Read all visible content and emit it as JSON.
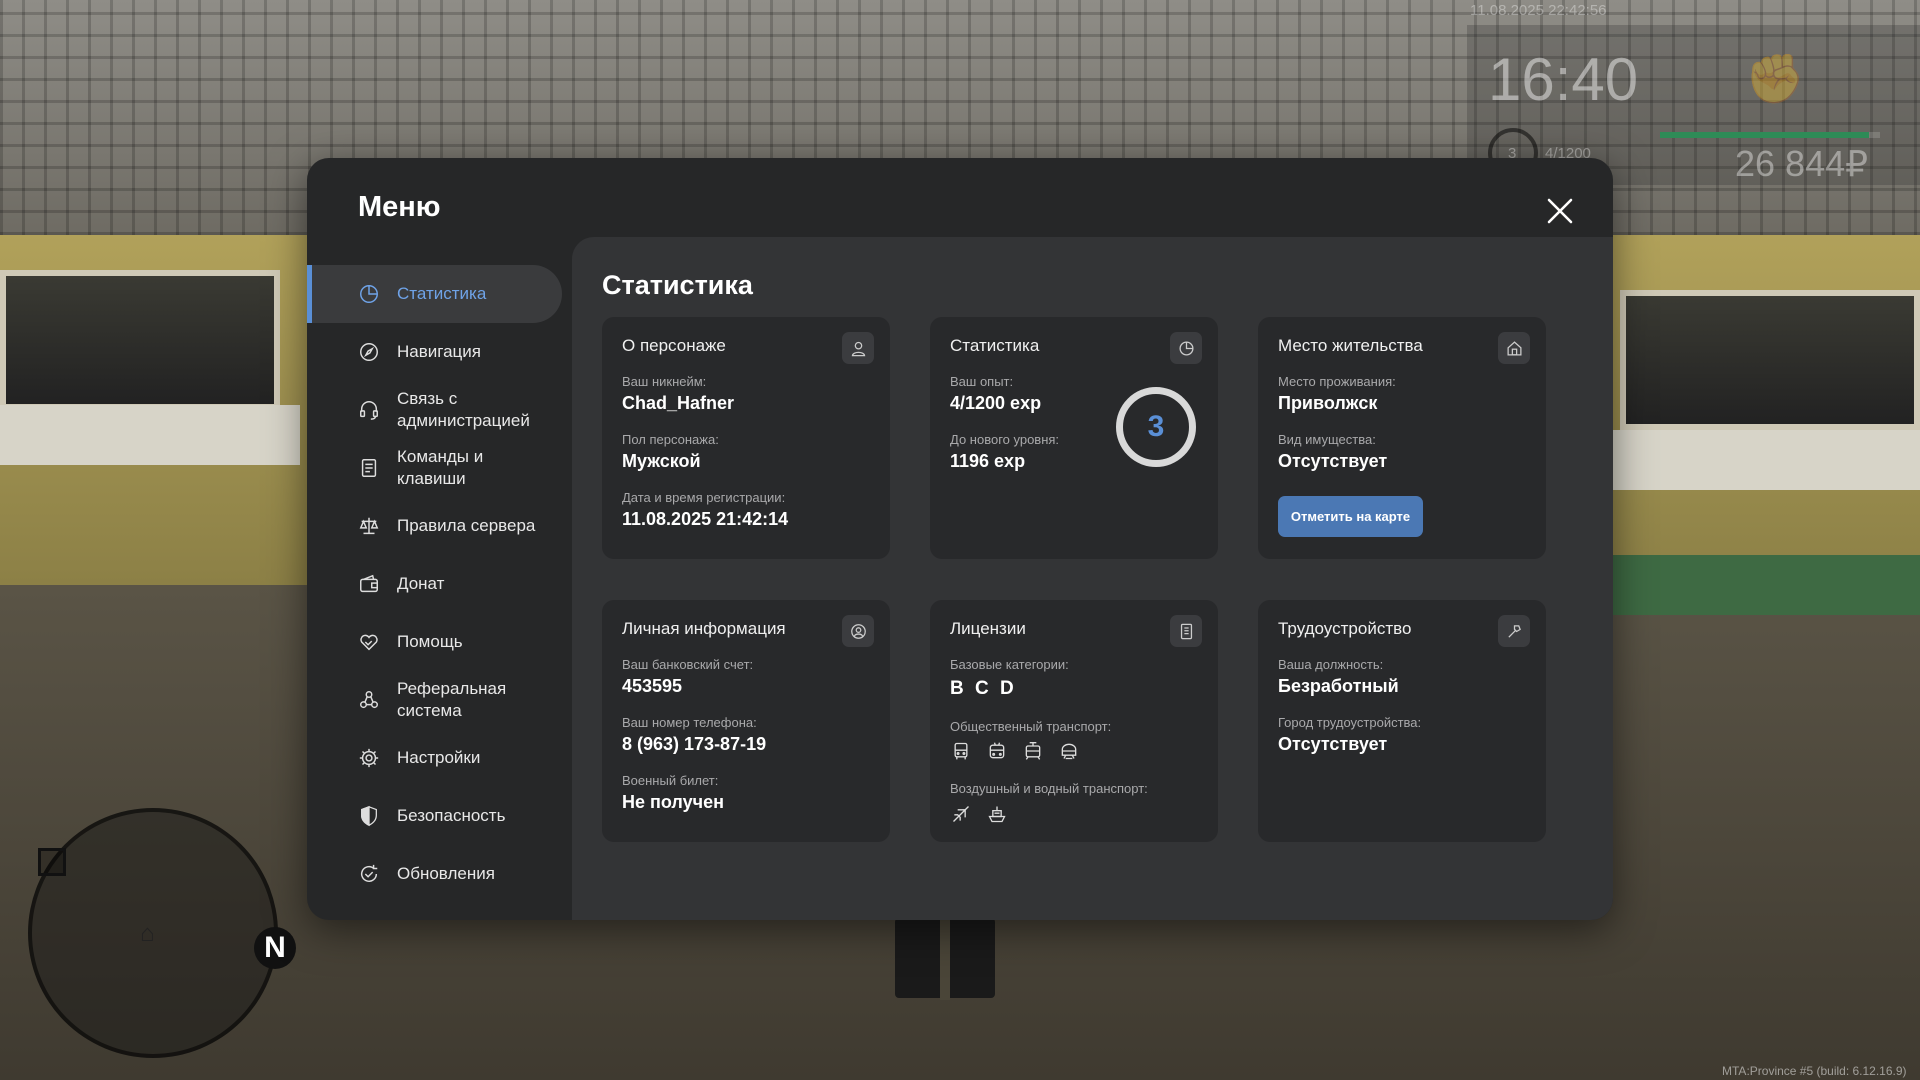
{
  "hud": {
    "datetime": "11.08.2025 22:42:56",
    "time": "16:40",
    "level": "3",
    "exp": "4/1200",
    "money": "26 844₽",
    "health_fraction": 0.95,
    "build": "MTA:Province #5 (build: 6.12.16.9)"
  },
  "minimap": {
    "north_label": "N"
  },
  "menu": {
    "title": "Меню",
    "sidebar": [
      {
        "label": "Статистика",
        "icon": "chart-pie-icon",
        "active": true
      },
      {
        "label": "Навигация",
        "icon": "compass-icon"
      },
      {
        "label": "Связь с администрацией",
        "icon": "headset-icon"
      },
      {
        "label": "Команды и клавиши",
        "icon": "document-list-icon"
      },
      {
        "label": "Правила сервера",
        "icon": "scales-icon"
      },
      {
        "label": "Донат",
        "icon": "wallet-icon"
      },
      {
        "label": "Помощь",
        "icon": "heart-hand-icon"
      },
      {
        "label": "Реферальная система",
        "icon": "people-network-icon"
      },
      {
        "label": "Настройки",
        "icon": "gear-icon"
      },
      {
        "label": "Безопасность",
        "icon": "shield-icon"
      },
      {
        "label": "Обновления",
        "icon": "refresh-check-icon"
      }
    ],
    "content_title": "Статистика",
    "cards": {
      "character": {
        "title": "О персонаже",
        "nickname_label": "Ваш никнейм:",
        "nickname": "Chad_Hafner",
        "gender_label": "Пол персонажа:",
        "gender": "Мужской",
        "reg_label": "Дата и время регистрации:",
        "reg_value": "11.08.2025 21:42:14"
      },
      "stats": {
        "title": "Статистика",
        "exp_label": "Ваш опыт:",
        "exp_value": "4/1200 exp",
        "next_label": "До нового уровня:",
        "next_value": "1196 exp",
        "level": "3"
      },
      "residence": {
        "title": "Место жительства",
        "place_label": "Место проживания:",
        "place_value": "Приволжск",
        "property_label": "Вид имущества:",
        "property_value": "Отсутствует",
        "map_button": "Отметить на карте"
      },
      "personal": {
        "title": "Личная информация",
        "bank_label": "Ваш банковский счет:",
        "bank_value": "453595",
        "phone_label": "Ваш номер телефона:",
        "phone_value": "8 (963) 173-87-19",
        "military_label": "Военный билет:",
        "military_value": "Не получен"
      },
      "licenses": {
        "title": "Лицензии",
        "base_label": "Базовые категории:",
        "base_value": "B C D",
        "public_label": "Общественный транспорт:",
        "public_icons": [
          "bus-icon",
          "trolleybus-icon",
          "tram-icon",
          "metro-icon"
        ],
        "air_label": "Воздушный и водный транспорт:",
        "air_icons": [
          "airplane-icon",
          "boat-icon"
        ]
      },
      "employment": {
        "title": "Трудоустройство",
        "position_label": "Ваша должность:",
        "position_value": "Безработный",
        "city_label": "Город трудоустройства:",
        "city_value": "Отсутствует"
      }
    }
  },
  "colors": {
    "accent": "#5a8fd6",
    "button": "#4b78b4",
    "window_bg": "#262728",
    "content_bg": "#333436",
    "card_bg": "#28292b"
  }
}
